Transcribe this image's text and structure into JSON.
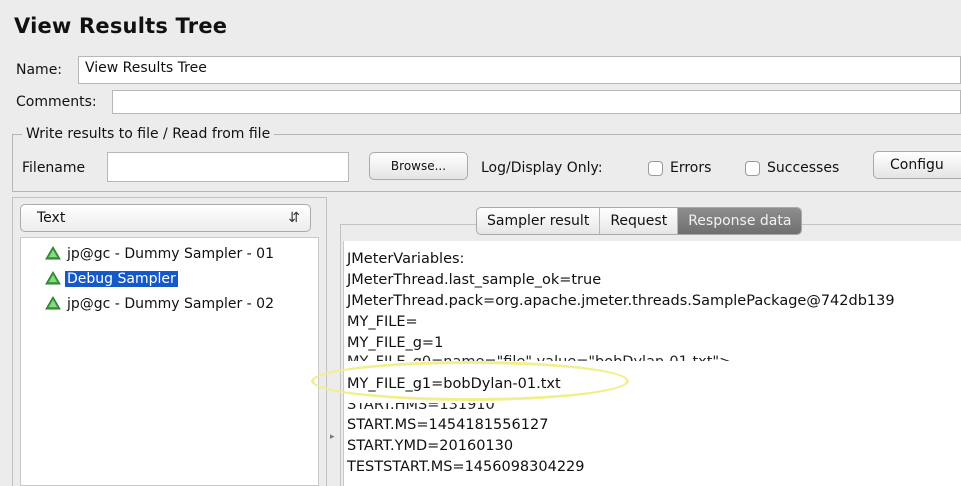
{
  "title": "View Results Tree",
  "name_field": {
    "label": "Name:",
    "value": "View Results Tree"
  },
  "comments_field": {
    "label": "Comments:",
    "value": ""
  },
  "file_group": {
    "title": "Write results to file / Read from file",
    "filename_label": "Filename",
    "filename_value": "",
    "browse_label": "Browse...",
    "log_display_label": "Log/Display Only:",
    "errors_label": "Errors",
    "successes_label": "Successes",
    "configure_label": "Configu"
  },
  "renderer_select": {
    "value": "Text"
  },
  "tree": {
    "items": [
      {
        "label": "jp@gc - Dummy Sampler - 01",
        "icon": "success-triangle-icon",
        "selected": false
      },
      {
        "label": "Debug Sampler",
        "icon": "success-triangle-icon",
        "selected": true
      },
      {
        "label": "jp@gc - Dummy Sampler - 02",
        "icon": "success-triangle-icon",
        "selected": false
      }
    ]
  },
  "tabs": [
    {
      "label": "Sampler result",
      "active": false
    },
    {
      "label": "Request",
      "active": false
    },
    {
      "label": "Response data",
      "active": true
    }
  ],
  "response_lines": [
    "JMeterVariables:",
    "JMeterThread.last_sample_ok=true",
    "JMeterThread.pack=org.apache.jmeter.threads.SamplePackage@742db139",
    "MY_FILE=",
    "MY_FILE_g=1",
    "MY_FILE_g0=name=\"file\" value=\"bobDylan-01.txt\">",
    "MY_FILE_g1=bobDylan-01.txt",
    "START.HMS=131910",
    "START.MS=1454181556127",
    "START.YMD=20160130",
    "TESTSTART.MS=1456098304229"
  ],
  "colors": {
    "selection": "#1559c9",
    "highlight_ellipse": "#f1ef8c",
    "icon_green": "#3aa53a"
  }
}
